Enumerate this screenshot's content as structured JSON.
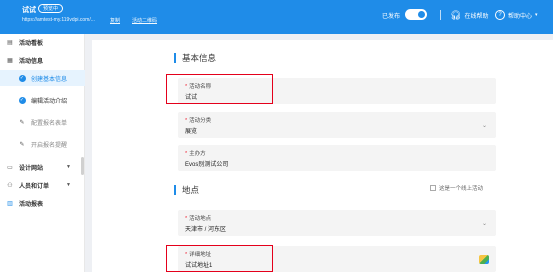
{
  "header": {
    "title": "试试",
    "badge": "预览中",
    "url": "https://amtest-my.119vdpi.com/...",
    "copy_link": "复制",
    "qr_link": "活动二维码",
    "published_label": "已发布",
    "online_help": "在线帮助",
    "help_center": "帮助中心",
    "brand_color": "#1f8ce8"
  },
  "sidebar": {
    "items": [
      {
        "label": "活动看板",
        "icon": "dashboard-icon"
      },
      {
        "label": "活动信息",
        "icon": "document-icon"
      },
      {
        "label": "创建基本信息",
        "icon": "check-circle-icon",
        "active": true
      },
      {
        "label": "编辑活动介绍",
        "icon": "check-circle-icon"
      },
      {
        "label": "配置报名表单",
        "icon": "pencil-icon"
      },
      {
        "label": "开启报名提醒",
        "icon": "pencil-icon"
      },
      {
        "label": "设计网站",
        "icon": "monitor-icon"
      },
      {
        "label": "人员和订单",
        "icon": "people-icon"
      },
      {
        "label": "活动报表",
        "icon": "bar-chart-icon"
      }
    ]
  },
  "basic_section": {
    "title": "基本信息",
    "activity_name": {
      "label": "活动名称",
      "value": "试试"
    },
    "activity_category": {
      "label": "活动分类",
      "value": "展览"
    },
    "organizer": {
      "label": "主办方",
      "value": "Evos别测试公司"
    }
  },
  "location_section": {
    "title": "地点",
    "online_checkbox": "这是一个线上活动",
    "activity_location": {
      "label": "活动地点",
      "value": "天津市 / 河东区"
    },
    "detail_address": {
      "label": "详细地址",
      "value": "试试地址1"
    }
  },
  "colors": {
    "accent": "#1f8ce8",
    "highlight_box": "#e4001b",
    "required_mark": "#e23333"
  }
}
